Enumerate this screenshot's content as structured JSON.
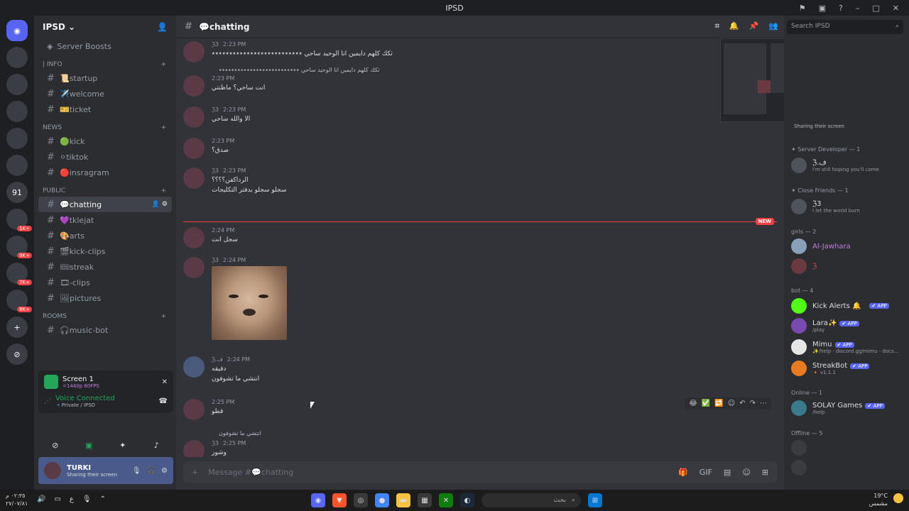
{
  "window": {
    "title": "IPSD"
  },
  "server": {
    "name": "IPSD ⌄",
    "boosts": "Server Boosts"
  },
  "guild_badges": [
    "1K+",
    "9K+",
    "7K+",
    "8K+"
  ],
  "guild_numbers": [
    "91"
  ],
  "categories": {
    "info": "| INFO",
    "news": "NEWS",
    "public": "PUBLIC",
    "rooms": "Rooms"
  },
  "channels": {
    "info": [
      "📜startup",
      "✈️welcome",
      "🎫ticket"
    ],
    "news": [
      "🟢kick",
      "⚪tiktok",
      "🔴insragram"
    ],
    "public": [
      "💬chatting",
      "💜tklejat",
      "🎨arts",
      "🎬kick-clips",
      "🎟streak",
      "🎞-clips",
      "🖼pictures"
    ],
    "rooms": [
      "🎧music-bot"
    ]
  },
  "voice": {
    "screen": "Screen 1",
    "screen_sub": "⚪1440p 60FPS",
    "status": "Voice Connected",
    "location": "🔹Private / IPSD"
  },
  "user": {
    "name": "TURKI",
    "status": "Sharing their screen"
  },
  "channel_header": {
    "name": "💬chatting",
    "search_placeholder": "Search IPSD"
  },
  "messages": [
    {
      "time": "2:23 PM",
      "text": "ثكك كلهم دايمين انا الوحيد ساحي ٭٭٭٭٭٭٭٭٭٭٭٭٭٭٭٭٭٭٭٭٭٭٭٭٭٭",
      "tag": "ℨ3"
    },
    {
      "reply": "ثكك كلهم دايمين انا الوحيد ساحي ٭٭٭٭٭٭٭٭٭٭٭٭٭٭٭٭٭٭٭٭٭٭٭٭٭٭",
      "time": "2:23 PM",
      "text": "انت ساحي؟ ماظنتي"
    },
    {
      "time": "2:23 PM",
      "text": "الا والله ساحي",
      "tag": "ℨ3"
    },
    {
      "time": "2:23 PM",
      "text": "صدق؟"
    },
    {
      "time": "2:23 PM",
      "text": "الرداكفن؟؟؟؟",
      "text2": "سجلو سجلو بدفتر التكليجات",
      "tag": "ℨ3"
    },
    {
      "time": "2:24 PM",
      "text": "سجل انت"
    },
    {
      "time": "2:24 PM",
      "text": "",
      "tag": "ℨ3",
      "image": true
    },
    {
      "time": "2:24 PM",
      "text": "دقيقه",
      "text2": "انتشي ما تشوفون",
      "tag": "ℨ.ف"
    },
    {
      "time": "2:25 PM",
      "text": "قطو"
    },
    {
      "reply": "انتشي ما تشوفون",
      "time": "2:25 PM",
      "text": "وشور",
      "tag": "ℨ3"
    }
  ],
  "new_label": "NEW",
  "composer": {
    "placeholder": "Message #💬chatting"
  },
  "members": {
    "sharing": "Sharing their screen",
    "server_dev": "✦ Server Developer — 1",
    "server_dev_member": {
      "name": "ℨ.ف",
      "sub": "I'm still hoping you'll come"
    },
    "close_friends": "✦ Close Friends — 1",
    "close_friend_member": {
      "name": "ℨ3",
      "sub": "I let the world burn"
    },
    "girls": "girls — 2",
    "girls_members": [
      "Al-Jawhara",
      "ℨ"
    ],
    "bot": "bot — 4",
    "bots": [
      {
        "name": "Kick Alerts 🔔",
        "sub": ""
      },
      {
        "name": "Lara✨",
        "sub": "/play"
      },
      {
        "name": "Mimu",
        "sub": "✨/help · discord.gg/mimu · docs..."
      },
      {
        "name": "StreakBot",
        "sub": "🔸 v1.1.1"
      }
    ],
    "app_label": "✔ APP",
    "online": "Online — 1",
    "online_member": {
      "name": "SOLAY Games",
      "sub": "/help"
    },
    "offline": "Offline — 5"
  },
  "taskbar": {
    "time": "٠٢:٣٥ م",
    "date": "٢٧/٠٧/٨١",
    "weather": "19°C",
    "weather_sub": "مشمس",
    "search": "بحث"
  }
}
